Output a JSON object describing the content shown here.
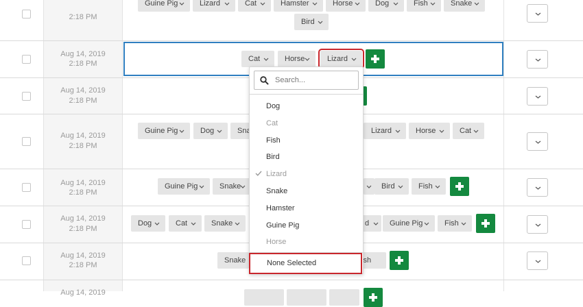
{
  "rows": [
    {
      "date": "",
      "time": "2:18 PM",
      "tags": [
        "Guine Pig",
        "Lizard",
        "Cat",
        "Hamster",
        "Horse",
        "Dog",
        "Fish",
        "Snake",
        "Bird"
      ]
    },
    {
      "date": "Aug 14, 2019",
      "time": "2:18 PM",
      "tags": [
        "Cat",
        "Horse",
        "Lizard"
      ]
    },
    {
      "date": "Aug 14, 2019",
      "time": "2:18 PM",
      "tags": []
    },
    {
      "date": "Aug 14, 2019",
      "time": "2:18 PM",
      "tags": [
        "Guine Pig",
        "Dog",
        "Sna",
        "Lizard",
        "Horse",
        "Cat"
      ]
    },
    {
      "date": "Aug 14, 2019",
      "time": "2:18 PM",
      "tags": [
        "Guine Pig",
        "Snake",
        "Bird",
        "Fish"
      ]
    },
    {
      "date": "Aug 14, 2019",
      "time": "2:18 PM",
      "tags": [
        "Dog",
        "Cat",
        "Snake",
        "d",
        "Guine Pig",
        "Fish"
      ]
    },
    {
      "date": "Aug 14, 2019",
      "time": "2:18 PM",
      "tags": [
        "Snake",
        "ish"
      ]
    },
    {
      "date": "Aug 14, 2019",
      "time": "",
      "tags": []
    }
  ],
  "dropdown": {
    "search_placeholder": "Search...",
    "items": [
      {
        "label": "Dog",
        "state": "available"
      },
      {
        "label": "Cat",
        "state": "used"
      },
      {
        "label": "Fish",
        "state": "available"
      },
      {
        "label": "Bird",
        "state": "available"
      },
      {
        "label": "Lizard",
        "state": "checked"
      },
      {
        "label": "Snake",
        "state": "available"
      },
      {
        "label": "Hamster",
        "state": "available"
      },
      {
        "label": "Guine Pig",
        "state": "available"
      },
      {
        "label": "Horse",
        "state": "used"
      }
    ],
    "none_selected": "None Selected"
  },
  "colors": {
    "accent_green": "#14893f",
    "highlight_red": "#c9262c",
    "selected_blue": "#2f7fc0"
  },
  "icons": {
    "search": "search-icon",
    "check": "check-icon",
    "chevron": "chevron-down-icon",
    "plus": "plus-icon"
  }
}
